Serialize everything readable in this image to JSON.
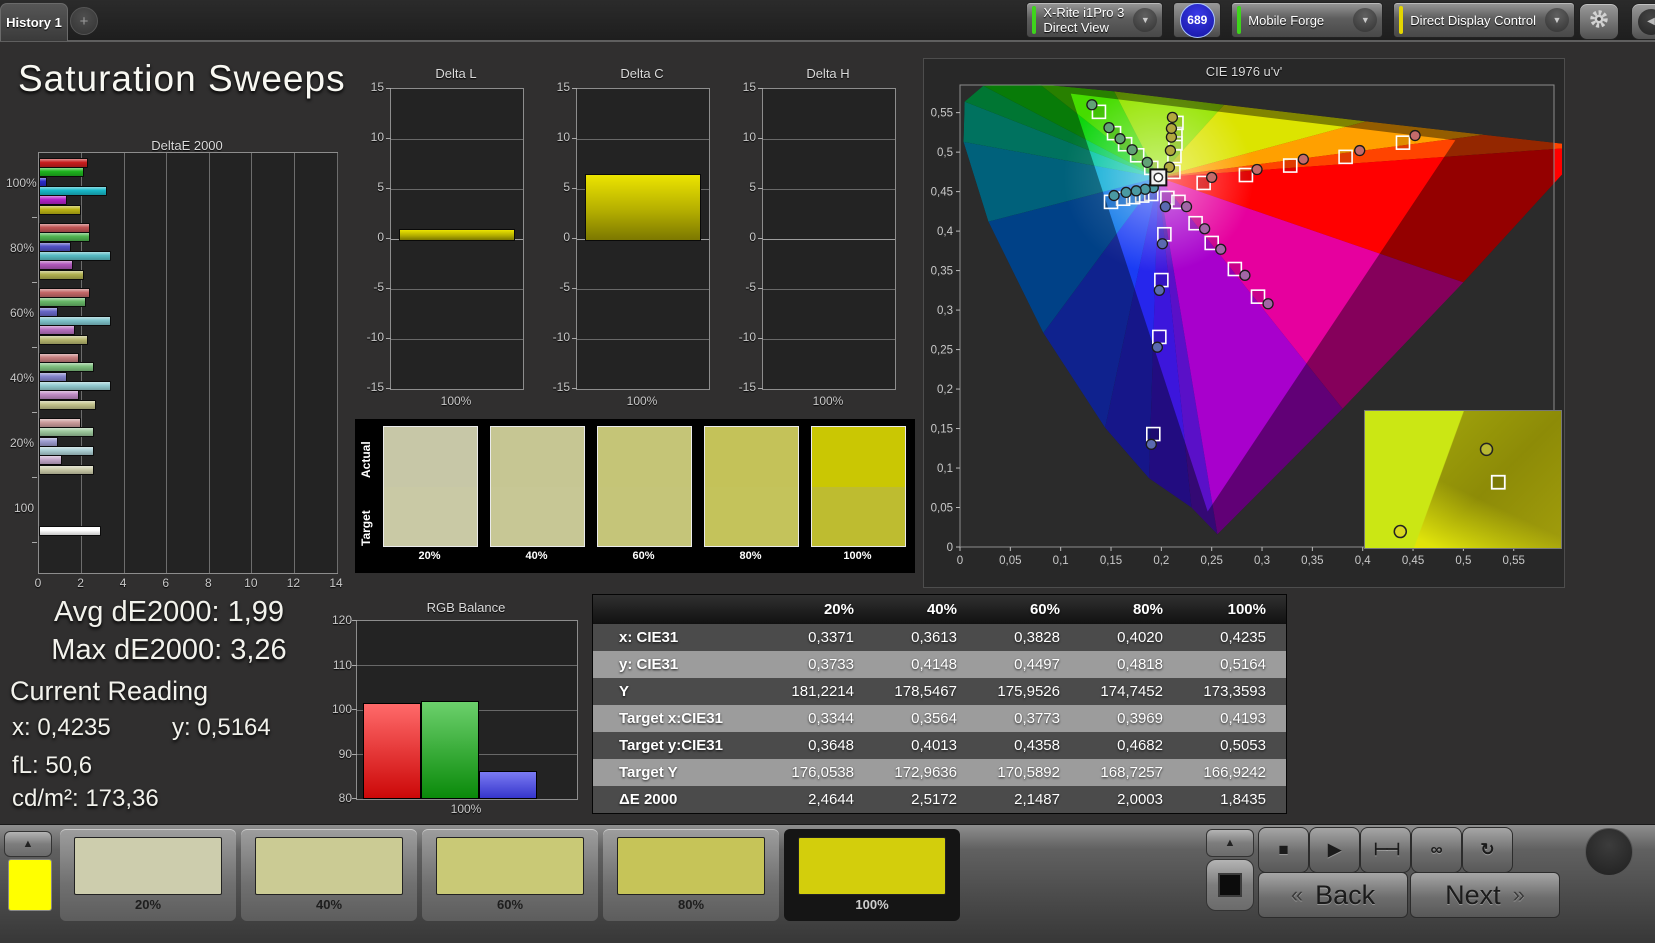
{
  "topbar": {
    "tab_label": "History 1",
    "add_tab_label": "+",
    "meters": [
      {
        "line1": "X-Rite i1Pro 3",
        "line2": "Direct View",
        "status_color": "#3ed41c"
      },
      {
        "line1": "Mobile Forge",
        "line2": "",
        "status_color": "#3ed41c"
      },
      {
        "line1": "Direct Display Control",
        "line2": "",
        "status_color": "#e4d600"
      }
    ],
    "badge": "689"
  },
  "page_title": "Saturation Sweeps",
  "deltae_chart": {
    "type": "bar",
    "title": "DeltaE 2000",
    "x_ticks": [
      "0",
      "2",
      "4",
      "6",
      "8",
      "10",
      "12",
      "14"
    ],
    "x_max": 14,
    "series_labels": [
      "red",
      "green",
      "blue",
      "cyan",
      "magenta",
      "yellow"
    ],
    "groups": [
      {
        "label": "100%",
        "values": [
          2.2,
          2.0,
          0.3,
          3.1,
          1.2,
          1.9
        ],
        "colors": [
          "#c81e1e",
          "#1eb41e",
          "#2a2ac8",
          "#18b8c8",
          "#b422c8",
          "#bcb414"
        ]
      },
      {
        "label": "80%",
        "values": [
          2.3,
          2.3,
          1.4,
          3.3,
          1.5,
          2.0
        ],
        "colors": [
          "#c05454",
          "#50b450",
          "#5050c4",
          "#58bcc4",
          "#b058bc",
          "#b0b050"
        ]
      },
      {
        "label": "60%",
        "values": [
          2.3,
          2.1,
          0.8,
          3.3,
          1.6,
          2.2
        ],
        "colors": [
          "#c46868",
          "#68b868",
          "#6868c8",
          "#80c4cc",
          "#b871c0",
          "#b8b870"
        ]
      },
      {
        "label": "40%",
        "values": [
          1.8,
          2.5,
          1.2,
          3.3,
          1.8,
          2.6
        ],
        "colors": [
          "#c88080",
          "#80c080",
          "#8484cc",
          "#94ccd2",
          "#c08cc6",
          "#c2c28c"
        ]
      },
      {
        "label": "20%",
        "values": [
          1.9,
          2.5,
          0.8,
          2.5,
          1.0,
          2.5
        ],
        "colors": [
          "#cc9c9c",
          "#9cc89c",
          "#9c9ccf",
          "#accfd4",
          "#c6aacc",
          "#ccccaa"
        ]
      },
      {
        "label": "100",
        "values": [
          2.8
        ],
        "colors": [
          "#ffffff"
        ],
        "single": true
      }
    ]
  },
  "delta_axis": {
    "min": -15,
    "max": 15,
    "ticks": [
      "15",
      "10",
      "5",
      "0",
      "-5",
      "-10",
      "-15"
    ]
  },
  "delta_charts": [
    {
      "title": "Delta L",
      "value": 1.0,
      "x_label": "100%"
    },
    {
      "title": "Delta C",
      "value": 6.5,
      "x_label": "100%"
    },
    {
      "title": "Delta H",
      "value": 0.0,
      "x_label": "100%"
    }
  ],
  "swatch_panel": {
    "row_labels": [
      "Actual",
      "Target"
    ],
    "swatches": [
      {
        "label": "20%",
        "actual": "#c7c7a7",
        "target": "#c9c9a5"
      },
      {
        "label": "40%",
        "actual": "#c6c693",
        "target": "#c7c795"
      },
      {
        "label": "60%",
        "actual": "#c5c577",
        "target": "#c5c579"
      },
      {
        "label": "80%",
        "actual": "#c4c259",
        "target": "#c4c35b"
      },
      {
        "label": "100%",
        "actual": "#cac703",
        "target": "#bebc30"
      }
    ]
  },
  "cie_chart": {
    "type": "scatter",
    "title": "CIE 1976 u'v'",
    "tick_labels": [
      "0",
      "0,05",
      "0,1",
      "0,15",
      "0,2",
      "0,25",
      "0,3",
      "0,35",
      "0,4",
      "0,45",
      "0,5",
      "0,55"
    ],
    "tick_step": 0.05,
    "u_max": 0.59,
    "v_max": 0.585,
    "white_point": [
      0.197,
      0.468
    ],
    "gamut_triangle": [
      [
        0.492,
        0.515
      ],
      [
        0.11,
        0.574
      ],
      [
        0.246,
        0.045
      ]
    ],
    "sweeps": [
      {
        "name": "red",
        "point_color": "#c46a6a",
        "measured": [
          [
            0.25,
            0.468
          ],
          [
            0.295,
            0.478
          ],
          [
            0.341,
            0.491
          ],
          [
            0.397,
            0.502
          ],
          [
            0.452,
            0.521
          ]
        ],
        "targets": [
          [
            0.242,
            0.461
          ],
          [
            0.284,
            0.471
          ],
          [
            0.328,
            0.483
          ],
          [
            0.383,
            0.494
          ],
          [
            0.44,
            0.512
          ]
        ]
      },
      {
        "name": "green",
        "point_color": "#62a276",
        "measured": [
          [
            0.186,
            0.487
          ],
          [
            0.171,
            0.503
          ],
          [
            0.159,
            0.517
          ],
          [
            0.148,
            0.531
          ],
          [
            0.131,
            0.56
          ]
        ],
        "targets": [
          [
            0.19,
            0.48
          ],
          [
            0.176,
            0.496
          ],
          [
            0.164,
            0.51
          ],
          [
            0.153,
            0.524
          ],
          [
            0.138,
            0.551
          ]
        ]
      },
      {
        "name": "blue",
        "point_color": "#5a6ab0",
        "measured": [
          [
            0.204,
            0.431
          ],
          [
            0.201,
            0.384
          ],
          [
            0.198,
            0.325
          ],
          [
            0.196,
            0.253
          ],
          [
            0.19,
            0.13
          ]
        ],
        "targets": [
          [
            0.206,
            0.442
          ],
          [
            0.203,
            0.396
          ],
          [
            0.2,
            0.338
          ],
          [
            0.198,
            0.266
          ],
          [
            0.192,
            0.143
          ]
        ]
      },
      {
        "name": "cyan",
        "point_color": "#4a9aa2",
        "measured": [
          [
            0.192,
            0.455
          ],
          [
            0.184,
            0.453
          ],
          [
            0.175,
            0.451
          ],
          [
            0.165,
            0.449
          ],
          [
            0.153,
            0.445
          ]
        ],
        "targets": [
          [
            0.19,
            0.447
          ],
          [
            0.181,
            0.445
          ],
          [
            0.172,
            0.443
          ],
          [
            0.162,
            0.441
          ],
          [
            0.15,
            0.437
          ]
        ]
      },
      {
        "name": "magenta",
        "point_color": "#a266a6",
        "measured": [
          [
            0.225,
            0.431
          ],
          [
            0.243,
            0.403
          ],
          [
            0.259,
            0.377
          ],
          [
            0.283,
            0.344
          ],
          [
            0.306,
            0.308
          ]
        ],
        "targets": [
          [
            0.217,
            0.437
          ],
          [
            0.234,
            0.41
          ],
          [
            0.25,
            0.385
          ],
          [
            0.273,
            0.352
          ],
          [
            0.296,
            0.317
          ]
        ]
      },
      {
        "name": "yellow",
        "point_color": "#b2a83e",
        "measured": [
          [
            0.208,
            0.481
          ],
          [
            0.209,
            0.502
          ],
          [
            0.21,
            0.519
          ],
          [
            0.21,
            0.53
          ],
          [
            0.211,
            0.544
          ]
        ],
        "targets": [
          [
            0.212,
            0.475
          ],
          [
            0.213,
            0.495
          ],
          [
            0.214,
            0.511
          ],
          [
            0.214,
            0.523
          ],
          [
            0.215,
            0.537
          ]
        ]
      }
    ],
    "inset_markers": {
      "circle_top": [
        0.62,
        0.28
      ],
      "square": [
        0.68,
        0.52
      ],
      "circle_bottom": [
        0.18,
        0.88
      ]
    }
  },
  "stats": {
    "avg_line": "Avg dE2000: 1,99",
    "max_line": "Max dE2000: 3,26",
    "current_title": "Current Reading",
    "x_reading": "x: 0,4235",
    "y_reading": "y: 0,5164",
    "fl_reading": "fL: 50,6",
    "cdm2_reading": "cd/m²: 173,36"
  },
  "rgb_balance": {
    "type": "bar",
    "title": "RGB Balance",
    "ticks": [
      "120",
      "110",
      "100",
      "90",
      "80"
    ],
    "min": 80,
    "max": 120,
    "x_label": "100%",
    "bars": [
      {
        "name": "red",
        "value": 101.1,
        "color_top": "#ff6a6a",
        "color_bottom": "#cc0808"
      },
      {
        "name": "green",
        "value": 101.6,
        "color_top": "#6cd06c",
        "color_bottom": "#0a8a0a"
      },
      {
        "name": "blue",
        "value": 85.8,
        "color_top": "#7a7af2",
        "color_bottom": "#3535cc"
      }
    ]
  },
  "table": {
    "columns": [
      "20%",
      "40%",
      "60%",
      "80%",
      "100%"
    ],
    "rows": [
      {
        "label": "x: CIE31",
        "values": [
          "0,3371",
          "0,3613",
          "0,3828",
          "0,4020",
          "0,4235"
        ]
      },
      {
        "label": "y: CIE31",
        "values": [
          "0,3733",
          "0,4148",
          "0,4497",
          "0,4818",
          "0,5164"
        ]
      },
      {
        "label": "Y",
        "values": [
          "181,2214",
          "178,5467",
          "175,9526",
          "174,7452",
          "173,3593"
        ]
      },
      {
        "label": "Target x:CIE31",
        "values": [
          "0,3344",
          "0,3564",
          "0,3773",
          "0,3969",
          "0,4193"
        ]
      },
      {
        "label": "Target y:CIE31",
        "values": [
          "0,3648",
          "0,4013",
          "0,4358",
          "0,4682",
          "0,5053"
        ]
      },
      {
        "label": "Target Y",
        "values": [
          "176,0538",
          "172,9636",
          "170,5892",
          "168,7257",
          "166,9242"
        ]
      },
      {
        "label": "ΔE 2000",
        "values": [
          "2,4644",
          "2,5172",
          "2,1487",
          "2,0003",
          "1,8435"
        ]
      }
    ]
  },
  "bottom_bar": {
    "up_arrow": "▲",
    "preview_color": "#ffff00",
    "patterns": [
      {
        "label": "20%",
        "color": "#cdcdad",
        "selected": false
      },
      {
        "label": "40%",
        "color": "#cbcb94",
        "selected": false
      },
      {
        "label": "60%",
        "color": "#c9c976",
        "selected": false
      },
      {
        "label": "80%",
        "color": "#c6c458",
        "selected": false
      },
      {
        "label": "100%",
        "color": "#d3ce0c",
        "selected": true
      }
    ],
    "window_icon": "■",
    "transport": [
      {
        "name": "stop",
        "glyph": "■"
      },
      {
        "name": "play",
        "glyph": "▶"
      },
      {
        "name": "pattern-window",
        "glyph": "⊢⊣"
      },
      {
        "name": "continuous",
        "glyph": "∞"
      },
      {
        "name": "refresh",
        "glyph": "↻"
      }
    ],
    "back_chevron": "«",
    "back_label": "Back",
    "next_label": "Next",
    "next_chevron": "»"
  }
}
